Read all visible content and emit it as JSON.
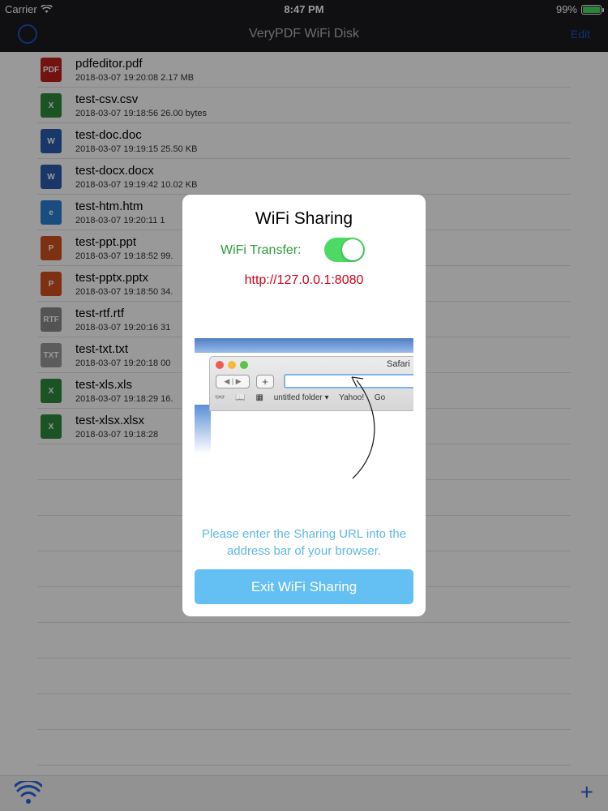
{
  "status_bar": {
    "carrier": "Carrier",
    "time": "8:47 PM",
    "battery": "99%",
    "battery_level": 0.99
  },
  "nav": {
    "title": "VeryPDF WiFi Disk",
    "edit_label": "Edit"
  },
  "files": [
    {
      "name": "pdfeditor.pdf",
      "date": "2018-03-07 19:20:08",
      "size": "2.17 MB",
      "icon": "pdf-file-icon",
      "color": "#c0211b",
      "glyph": "PDF"
    },
    {
      "name": "test-csv.csv",
      "date": "2018-03-07 19:18:56",
      "size": "26.00 bytes",
      "icon": "excel-file-icon",
      "color": "#2e8b3d",
      "glyph": "X"
    },
    {
      "name": "test-doc.doc",
      "date": "2018-03-07 19:19:15",
      "size": "25.50 KB",
      "icon": "word-file-icon",
      "color": "#2a5db0",
      "glyph": "W"
    },
    {
      "name": "test-docx.docx",
      "date": "2018-03-07 19:19:42",
      "size": "10.02 KB",
      "icon": "word-file-icon",
      "color": "#2a5db0",
      "glyph": "W"
    },
    {
      "name": "test-htm.htm",
      "date": "2018-03-07 19:20:11",
      "size": "1",
      "icon": "web-file-icon",
      "color": "#2b7fd4",
      "glyph": "e"
    },
    {
      "name": "test-ppt.ppt",
      "date": "2018-03-07 19:18:52",
      "size": "99.",
      "icon": "powerpoint-file-icon",
      "color": "#d2501f",
      "glyph": "P"
    },
    {
      "name": "test-pptx.pptx",
      "date": "2018-03-07 19:18:50",
      "size": "34.",
      "icon": "powerpoint-file-icon",
      "color": "#d2501f",
      "glyph": "P"
    },
    {
      "name": "test-rtf.rtf",
      "date": "2018-03-07 19:20:16",
      "size": "31",
      "icon": "rtf-file-icon",
      "color": "#8a8a8a",
      "glyph": "RTF"
    },
    {
      "name": "test-txt.txt",
      "date": "2018-03-07 19:20:18",
      "size": "00",
      "icon": "text-file-icon",
      "color": "#9a9a9a",
      "glyph": "TXT"
    },
    {
      "name": "test-xls.xls",
      "date": "2018-03-07 19:18:29",
      "size": "16.",
      "icon": "excel-file-icon",
      "color": "#2e8b3d",
      "glyph": "X"
    },
    {
      "name": "test-xlsx.xlsx",
      "date": "2018-03-07 19:18:28",
      "size": "",
      "icon": "excel-file-icon",
      "color": "#2e8b3d",
      "glyph": "X"
    }
  ],
  "dialog": {
    "title": "WiFi Sharing",
    "transfer_label": "WiFi Transfer:",
    "transfer_on": true,
    "url": "http://127.0.0.1:8080",
    "illustration": {
      "window_title": "Safari",
      "bookmarks": [
        "untitled folder ▾",
        "Yahoo!",
        "Go"
      ]
    },
    "instructions": "Please enter the Sharing URL into the address bar of your browser.",
    "exit_label": "Exit WiFi Sharing"
  },
  "toolbar": {
    "left_icon": "wifi-icon",
    "right_icon": "add-icon"
  },
  "colors": {
    "accent": "#64bff3",
    "toggle_on": "#4cd964",
    "url_red": "#d0021b",
    "label_green": "#2e9b3a"
  }
}
